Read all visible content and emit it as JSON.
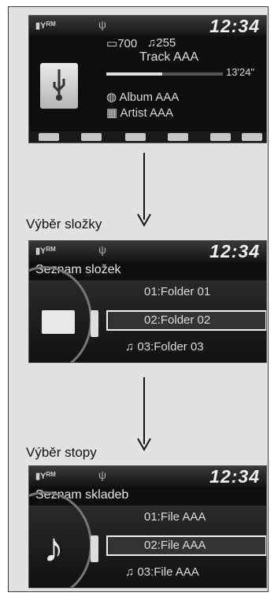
{
  "screen1": {
    "clock": "12:34",
    "signal": "RM",
    "folder_count": "700",
    "track_count": "255",
    "track": "Track AAA",
    "time": "13'24\"",
    "album": "Album AAA",
    "artist": "Artist AAA"
  },
  "caption1": "Výběr složky",
  "screen2": {
    "clock": "12:34",
    "signal": "RM",
    "title": "Seznam složek",
    "items": [
      "01:Folder 01",
      "02:Folder 02",
      "03:Folder 03"
    ]
  },
  "caption2": "Výběr stopy",
  "screen3": {
    "clock": "12:34",
    "signal": "RM",
    "title": "Seznam skladeb",
    "items": [
      "01:File AAA",
      "02:File AAA",
      "03:File AAA"
    ]
  },
  "icons": [
    "battery-icon",
    "signal-icon",
    "usb-icon",
    "folder-icon",
    "music-note-icon",
    "arrow-down-icon"
  ]
}
